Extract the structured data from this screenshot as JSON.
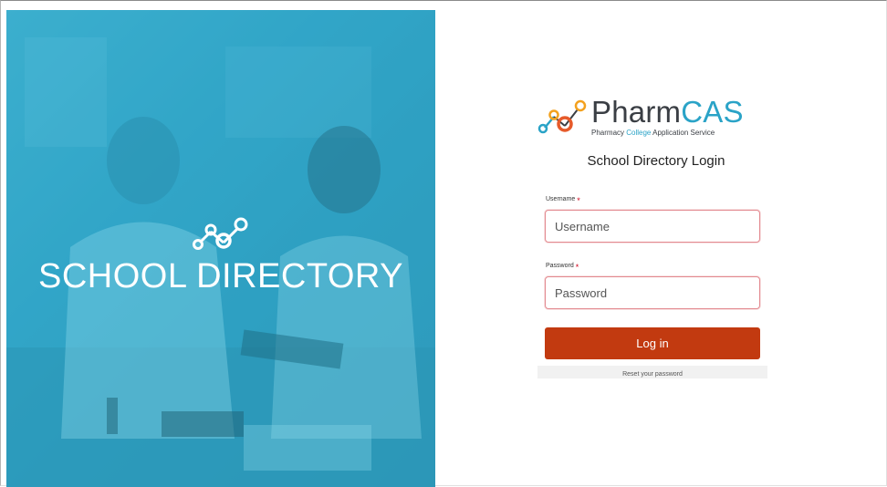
{
  "hero": {
    "title": "SCHOOL DIRECTORY",
    "background_color": "#2fa4c6"
  },
  "brand": {
    "name_main": "Pharm",
    "name_accent": "CAS",
    "subtitle_part1": "Pharmacy ",
    "subtitle_accent": "College",
    "subtitle_part2": " Application Service",
    "accent_color": "#2aa3c7",
    "logo_colors": [
      "#2aa3c7",
      "#e65a2a",
      "#f3a11e"
    ]
  },
  "login": {
    "heading": "School Directory Login",
    "username": {
      "label": "Username",
      "required_mark": "*",
      "placeholder": "Username",
      "value": ""
    },
    "password": {
      "label": "Password",
      "required_mark": "*",
      "placeholder": "Password",
      "value": ""
    },
    "submit_label": "Log in",
    "submit_color": "#c23a10",
    "reset_link": "Reset your password"
  }
}
